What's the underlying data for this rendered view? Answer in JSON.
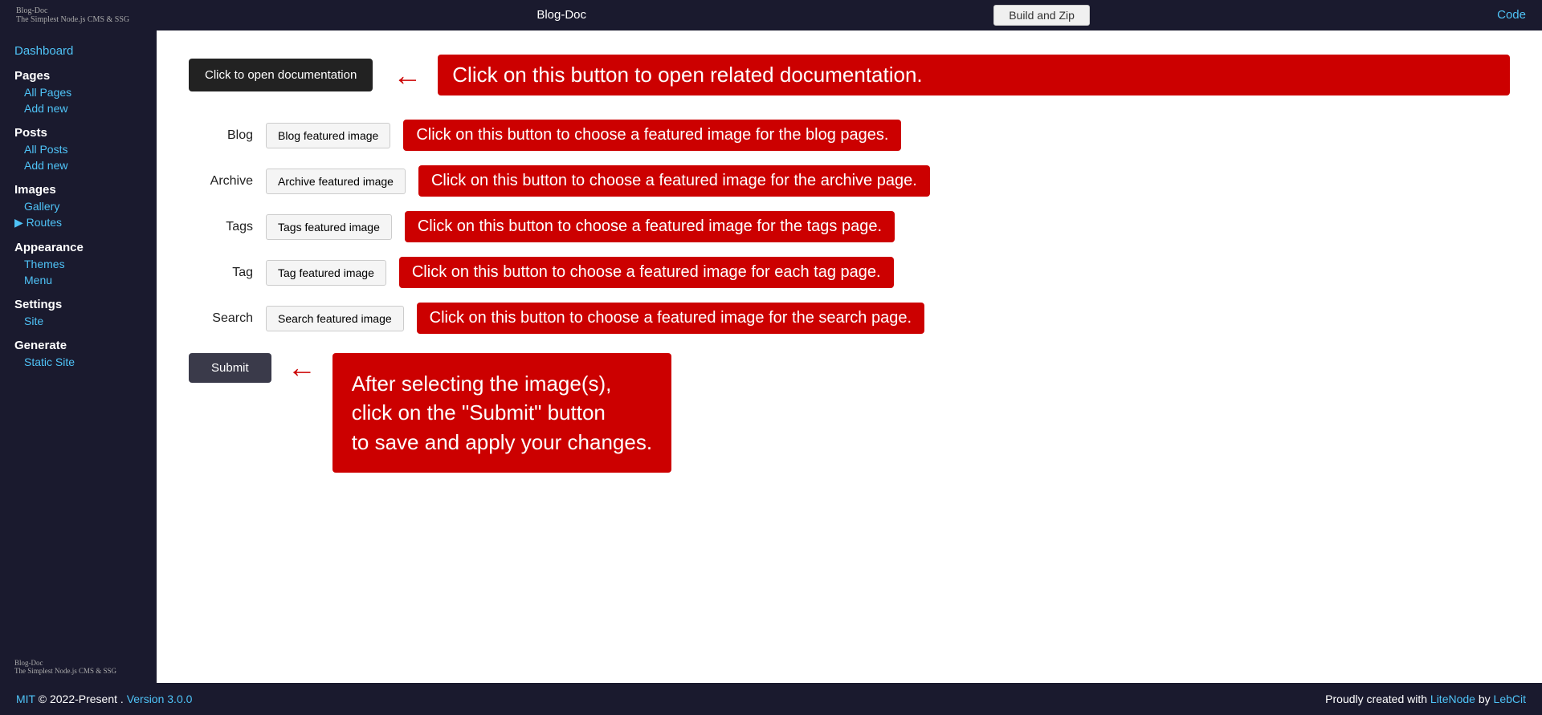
{
  "topnav": {
    "logo": "Blog-Doc",
    "logo_sub": "The Simplest Node.js CMS & SSG",
    "center_link": "Blog-Doc",
    "build_label": "Build and Zip",
    "code_label": "Code"
  },
  "sidebar": {
    "dashboard_label": "Dashboard",
    "pages_label": "Pages",
    "all_pages_label": "All Pages",
    "add_new_pages_label": "Add new",
    "posts_label": "Posts",
    "all_posts_label": "All Posts",
    "add_new_posts_label": "Add new",
    "images_label": "Images",
    "gallery_label": "Gallery",
    "routes_label": "▶ Routes",
    "appearance_label": "Appearance",
    "themes_label": "Themes",
    "menu_label": "Menu",
    "settings_label": "Settings",
    "site_label": "Site",
    "generate_label": "Generate",
    "static_site_label": "Static Site",
    "footer_logo": "Blog-Doc",
    "footer_logo_sub": "The Simplest Node.js CMS & SSG"
  },
  "main": {
    "doc_btn_label": "Click to open documentation",
    "doc_tooltip": "Click on this button to open related documentation.",
    "blog_label": "Blog",
    "blog_btn_label": "Blog featured image",
    "blog_tooltip": "Click on this button to choose a featured image for the blog pages.",
    "archive_label": "Archive",
    "archive_btn_label": "Archive featured image",
    "archive_tooltip": "Click on this button to choose a featured image for the archive page.",
    "tags_label": "Tags",
    "tags_btn_label": "Tags featured image",
    "tags_tooltip": "Click on this button to choose a featured image for the tags page.",
    "tag_label": "Tag",
    "tag_btn_label": "Tag featured image",
    "tag_tooltip": "Click on this button to choose a featured image for each tag page.",
    "search_label": "Search",
    "search_btn_label": "Search featured image",
    "search_tooltip": "Click on this button to choose a featured image for the search page.",
    "submit_label": "Submit",
    "submit_tooltip_line1": "After selecting the image(s),",
    "submit_tooltip_line2": "click on the \"Submit\" button",
    "submit_tooltip_line3": "to save and apply your changes."
  },
  "footer": {
    "mit_label": "MIT",
    "copyright": "© 2022-Present .",
    "version_label": "Version 3.0.0",
    "proudly": "Proudly created with",
    "litenode": "LiteNode",
    "by": "by",
    "lebcit": "LebCit"
  }
}
